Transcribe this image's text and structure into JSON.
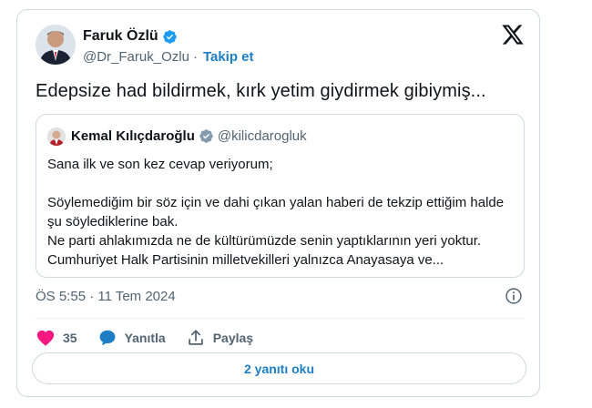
{
  "author": {
    "name": "Faruk Özlü",
    "handle": "@Dr_Faruk_Ozlu",
    "separator": "·",
    "follow_label": "Takip et"
  },
  "icons": {
    "verified": "verified-badge-icon",
    "logo": "x-logo-icon",
    "info": "info-icon",
    "like": "heart-icon",
    "reply": "reply-bubble-icon",
    "share": "share-icon"
  },
  "colors": {
    "accent": "#1d9bf0",
    "link": "#1d7ec5",
    "like": "#f91880",
    "muted": "#536471",
    "border": "#cfd9de"
  },
  "tweet": {
    "text": "Edepsize had bildirmek, kırk yetim giydirmek gibiymiş..."
  },
  "quote": {
    "name": "Kemal Kılıçdaroğlu",
    "handle": "@kilicdarogluk",
    "line1": "Sana ilk ve son kez cevap veriyorum;",
    "line2": "Söylemediğim bir söz için ve dahi çıkan yalan haberi de tekzip ettiğim halde şu söylediklerine bak.",
    "line3": "Ne parti ahlakımızda ne de kültürümüzde senin yaptıklarının yeri yoktur.",
    "line4": "Cumhuriyet Halk Partisinin milletvekilleri yalnızca Anayasaya ve..."
  },
  "meta": {
    "timestamp": "ÖS 5:55 · 11 Tem 2024"
  },
  "actions": {
    "like_count": "35",
    "reply_label": "Yanıtla",
    "share_label": "Paylaş"
  },
  "replies_button": {
    "label": "2 yanıtı oku"
  }
}
